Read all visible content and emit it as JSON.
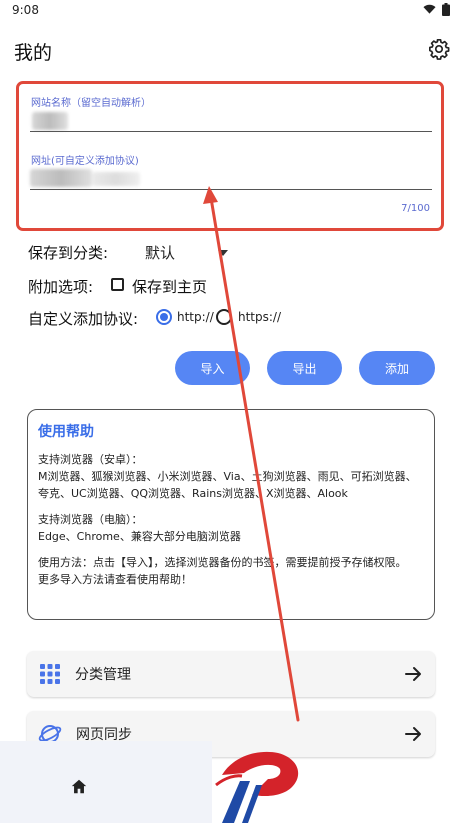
{
  "status_bar": {
    "time": "9:08",
    "icons": [
      "wifi-icon",
      "battery-icon"
    ]
  },
  "header": {
    "title": "我的",
    "settings_icon": "gear-icon"
  },
  "form": {
    "site_name_label": "网站名称（留空自动解析）",
    "url_label": "网址(可自定义添加协议)",
    "counter": "7/100"
  },
  "category": {
    "label": "保存到分类:",
    "value": "默认"
  },
  "options": {
    "label": "附加选项:",
    "checkbox_label": "保存到主页"
  },
  "protocol": {
    "label": "自定义添加协议:",
    "http": "http://",
    "https": "https://",
    "selected": "http://"
  },
  "buttons": {
    "import": "导入",
    "export": "导出",
    "add": "添加"
  },
  "help": {
    "title": "使用帮助",
    "android": "支持浏览器（安卓）：\nM浏览器、狐猴浏览器、小米浏览器、Via、土狗浏览器、雨见、可拓浏览器、夸克、UC浏览器、QQ浏览器、Rains浏览器、X浏览器、Alook",
    "pc": "支持浏览器（电脑）：\nEdge、Chrome、兼容大部分电脑浏览器",
    "usage": "使用方法：点击【导入】，选择浏览器备份的书签，需要提前授予存储权限。\n更多导入方法请查看使用帮助！"
  },
  "cards": [
    {
      "label": "分类管理",
      "icon": "grid-icon"
    },
    {
      "label": "网页同步",
      "icon": "planet-icon"
    }
  ],
  "colors": {
    "accent": "#5686f4",
    "highlight": "#e0483a",
    "label_blue": "#5b6bd0"
  }
}
